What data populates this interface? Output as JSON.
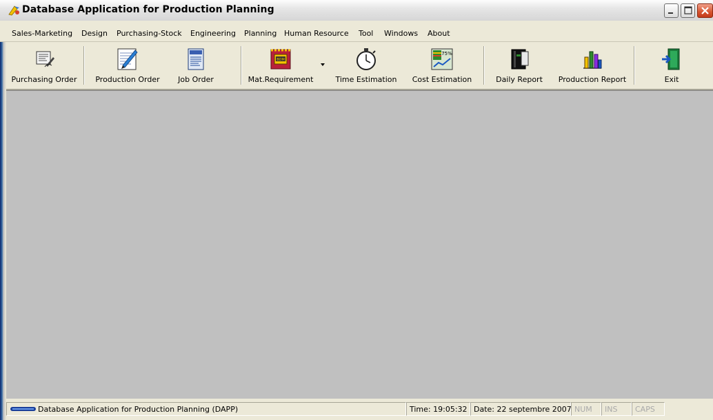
{
  "window": {
    "title": "Database Application for Production Planning"
  },
  "menu": [
    {
      "label": "Sales-Marketing"
    },
    {
      "label": "Design"
    },
    {
      "label": "Purchasing-Stock"
    },
    {
      "label": "Engineering"
    },
    {
      "label": "Planning"
    },
    {
      "label": "Human Resource"
    },
    {
      "label": "Tool"
    },
    {
      "label": "Windows"
    },
    {
      "label": "About"
    }
  ],
  "toolbar": {
    "purchasing_order": {
      "label": "Purchasing Order",
      "icon": "quill-document-icon"
    },
    "production_order": {
      "label": "Production Order",
      "icon": "pen-notepad-icon"
    },
    "job_order": {
      "label": "Job Order",
      "icon": "document-icon"
    },
    "mat_requirement": {
      "label": "Mat.Requirement",
      "icon": "material-box-icon"
    },
    "time_estimation": {
      "label": "Time Estimation",
      "icon": "stopwatch-icon"
    },
    "cost_estimation": {
      "label": "Cost Estimation",
      "icon": "cost-chart-icon",
      "badge": "75%"
    },
    "daily_report": {
      "label": "Daily Report",
      "icon": "binder-icon"
    },
    "production_report": {
      "label": "Production Report",
      "icon": "bar-chart-icon"
    },
    "exit": {
      "label": "Exit",
      "icon": "exit-door-icon"
    }
  },
  "statusbar": {
    "app_text": "Database Application for Production Planning (DAPP)",
    "time": "Time: 19:05:32",
    "date": "Date: 22 septembre 2007",
    "num": "NUM",
    "ins": "INS",
    "caps": "CAPS"
  },
  "colors": {
    "client_background": "#c0c0c0",
    "chrome": "#ece9d8",
    "close_button": "#d6532f"
  }
}
